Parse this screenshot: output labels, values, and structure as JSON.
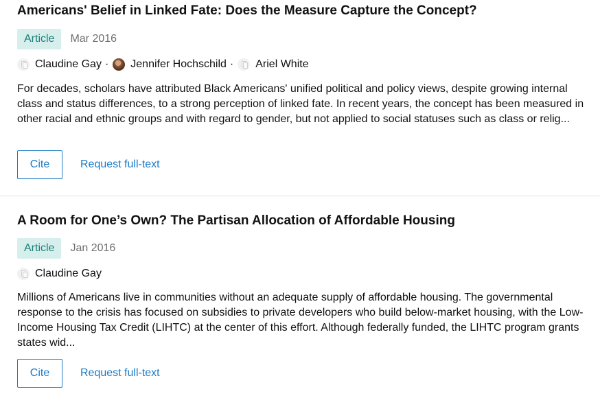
{
  "results": [
    {
      "title": "Americans' Belief in Linked Fate: Does the Measure Capture the Concept?",
      "type": "Article",
      "date": "Mar 2016",
      "authors": [
        {
          "name": "Claudine Gay",
          "avatar": "placeholder-avatar-icon"
        },
        {
          "name": "Jennifer Hochschild",
          "avatar": "photo-avatar"
        },
        {
          "name": "Ariel White",
          "avatar": "placeholder-avatar-icon"
        }
      ],
      "separator": "·",
      "abstract": "For decades, scholars have attributed Black Americans' unified political and policy views, despite growing internal class and status differences, to a strong perception of linked fate. In recent years, the concept has been measured in other racial and ethnic groups and with regard to gender, but not applied to social statuses such as class or relig...",
      "cite_label": "Cite",
      "request_label": "Request full-text"
    },
    {
      "title": "A Room for One’s Own? The Partisan Allocation of Affordable Housing",
      "type": "Article",
      "date": "Jan 2016",
      "authors": [
        {
          "name": "Claudine Gay",
          "avatar": "placeholder-avatar-icon"
        }
      ],
      "abstract": "Millions of Americans live in communities without an adequate supply of affordable housing. The governmental response to the crisis has focused on subsidies to private developers who build below-market housing, with the Low-Income Housing Tax Credit (LIHTC) at the center of this effort. Although federally funded, the LIHTC program grants states wid...",
      "cite_label": "Cite",
      "request_label": "Request full-text"
    }
  ],
  "colors": {
    "badge_bg": "#d6eeec",
    "badge_text": "#1d7f77",
    "link": "#1a7bc6",
    "date": "#6f6f6f",
    "divider": "#e3e3e3"
  }
}
